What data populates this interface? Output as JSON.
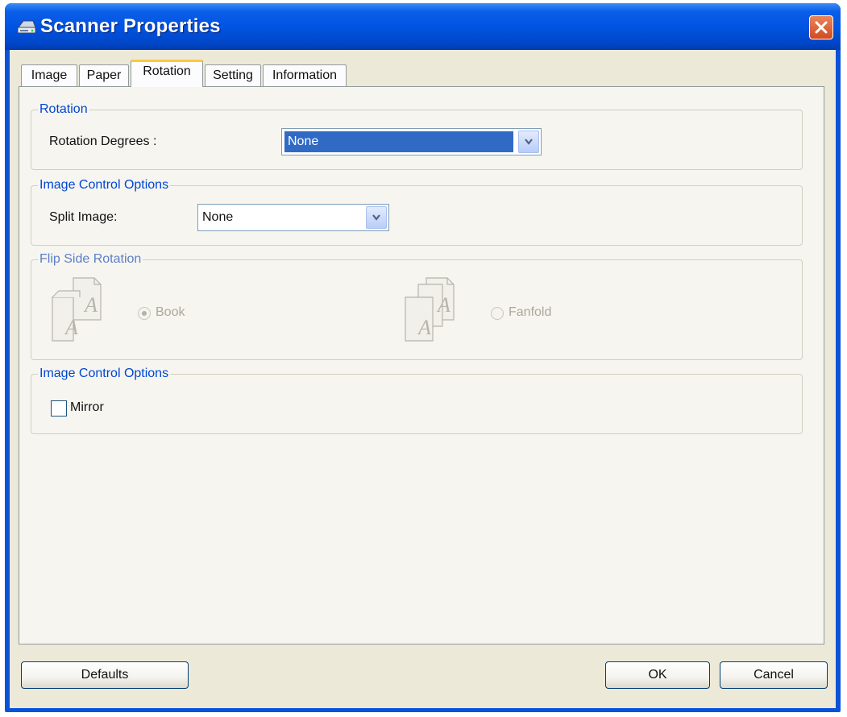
{
  "window": {
    "title": "Scanner Properties"
  },
  "tabs": [
    {
      "label": "Image"
    },
    {
      "label": "Paper"
    },
    {
      "label": "Rotation",
      "active": true
    },
    {
      "label": "Setting"
    },
    {
      "label": "Information"
    }
  ],
  "rotation_group": {
    "title": "Rotation",
    "degrees_label": "Rotation Degrees :",
    "degrees_value": "None"
  },
  "image_control_group": {
    "title": "Image Control Options",
    "split_label": "Split Image:",
    "split_value": "None"
  },
  "flip_group": {
    "title": "Flip Side Rotation",
    "book_label": "Book",
    "fanfold_label": "Fanfold",
    "selected": "Book",
    "enabled": false
  },
  "mirror_group": {
    "title": "Image Control Options",
    "mirror_label": "Mirror",
    "mirror_checked": false
  },
  "buttons": {
    "defaults": "Defaults",
    "ok": "OK",
    "cancel": "Cancel"
  },
  "colors": {
    "titlebar": "#0054e3",
    "group_title": "#0046d5",
    "selection": "#316ac5",
    "dialog_bg": "#ece9d8"
  }
}
